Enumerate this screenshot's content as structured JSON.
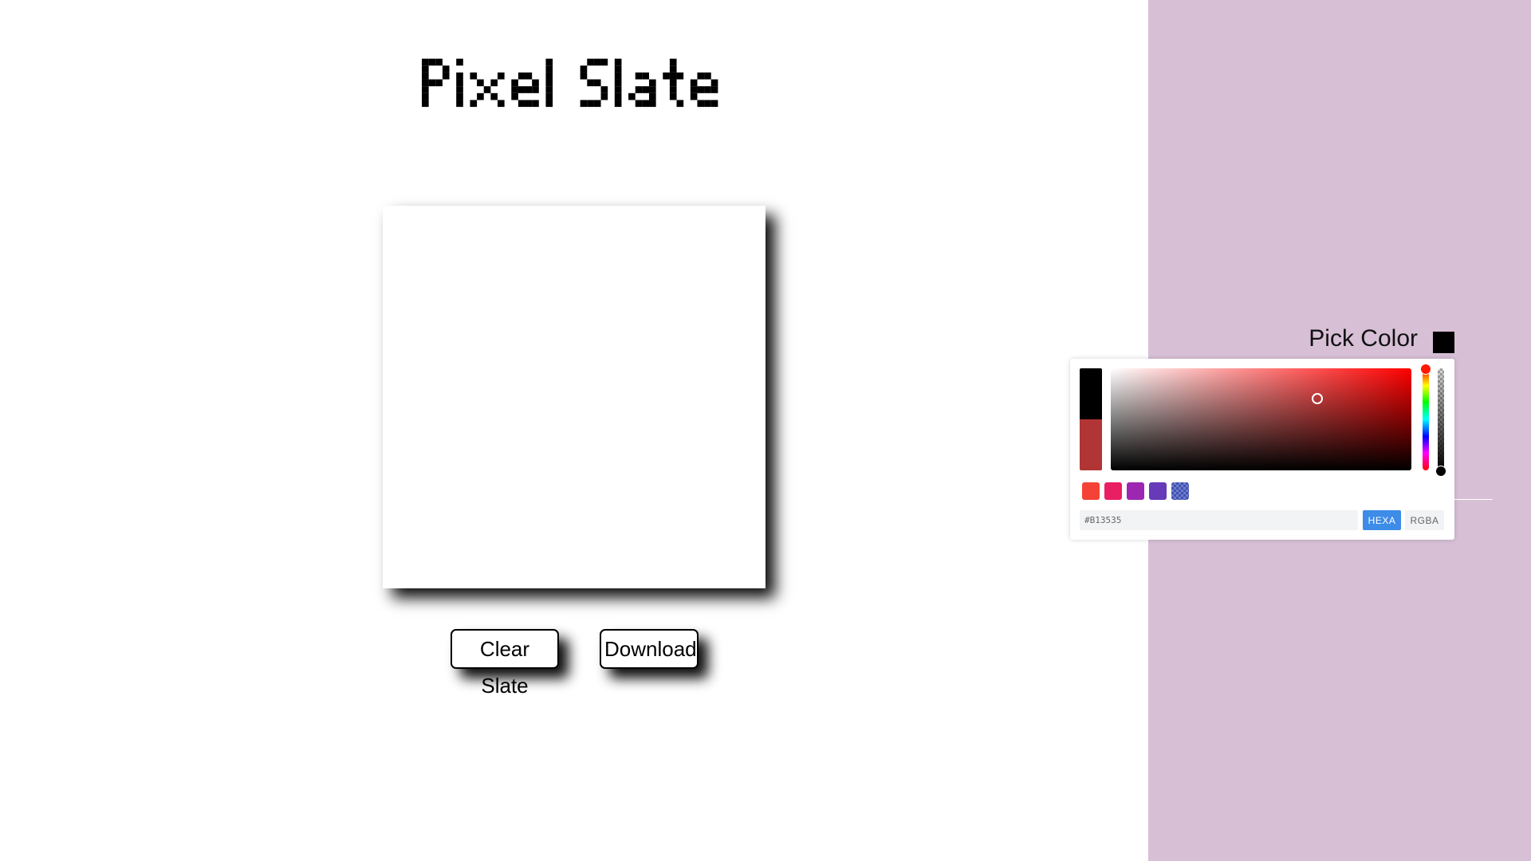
{
  "app": {
    "title": "Pixel Slate"
  },
  "actions": {
    "clear_label": "Clear Slate",
    "download_label": "Download"
  },
  "color_panel": {
    "pick_label": "Pick Color",
    "current_color": "#000000",
    "background": "#d7bfd6"
  },
  "picker": {
    "previous_color": "#000000",
    "new_color": "#B13535",
    "hue_color": "#ff0000",
    "hex_value": "#B13535",
    "modes": {
      "hexa": "HEXA",
      "rgba": "RGBA",
      "active": "HEXA",
      "active_color": "#3d8ce8"
    },
    "swatches": [
      {
        "name": "red",
        "color": "#f44336"
      },
      {
        "name": "pink",
        "color": "#e91e63"
      },
      {
        "name": "purple",
        "color": "#9c27b0"
      },
      {
        "name": "deep-purple",
        "color": "#673ab7"
      },
      {
        "name": "indigo",
        "color": "#3f51b5"
      }
    ]
  }
}
